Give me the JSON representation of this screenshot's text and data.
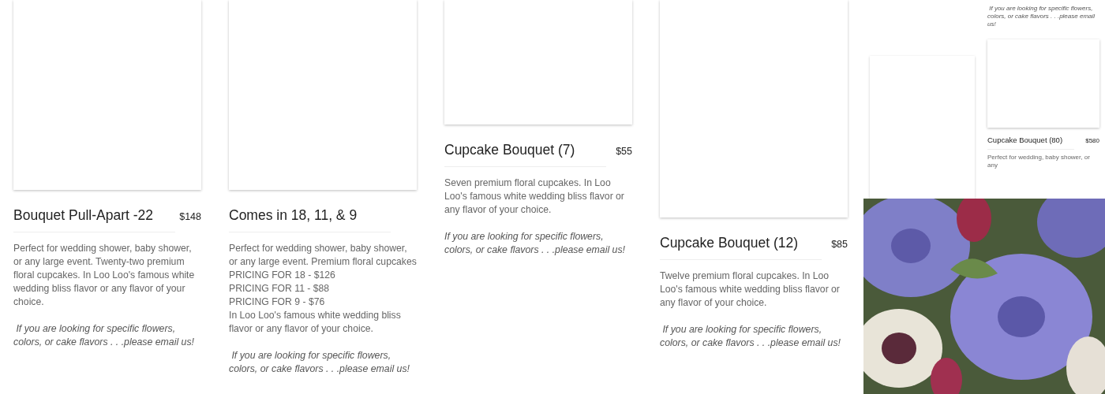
{
  "products": [
    {
      "title": "Bouquet Pull-Apart -22",
      "price": "$148",
      "description": "Perfect for wedding shower, baby shower, or any large event. Twenty-two premium floral cupcakes. In Loo Loo's famous white wedding bliss flavor or any flavor of your choice.",
      "note": " If you are looking for specific flowers, colors, or cake flavors . . .please email us!"
    },
    {
      "title": "Comes in 18, 11, & 9",
      "description": "Perfect for wedding shower, baby shower, or any large event. Premium floral cupcakes\nPRICING FOR 18 - $126\nPRICING FOR 11 - $88\nPRICING FOR 9 - $76\nIn Loo Loo's famous white wedding bliss flavor or any flavor of your choice.",
      "note": " If you are looking for specific flowers, colors, or cake flavors . . .please email us!"
    },
    {
      "title": "Cupcake Bouquet (7)",
      "price": "$55",
      "description": "Seven premium floral cupcakes. In Loo Loo's famous white wedding bliss flavor or any flavor of your choice.",
      "note": "If you are looking for specific flowers, colors, or cake flavors . . .please email us!"
    },
    {
      "title": "Cupcake Bouquet (12)",
      "price": "$85",
      "description": "Twelve premium floral cupcakes. In Loo Loo's famous white wedding bliss flavor or any flavor of your choice.",
      "note": " If you are looking for specific flowers, colors, or cake flavors . . .please email us!"
    }
  ],
  "preview": {
    "note": " If you are looking for specific flowers, colors, or cake flavors . . .please email us!",
    "product": {
      "title": "Cupcake Bouquet (80)",
      "price": "$580",
      "description": "Perfect for wedding, baby shower, or any"
    }
  }
}
